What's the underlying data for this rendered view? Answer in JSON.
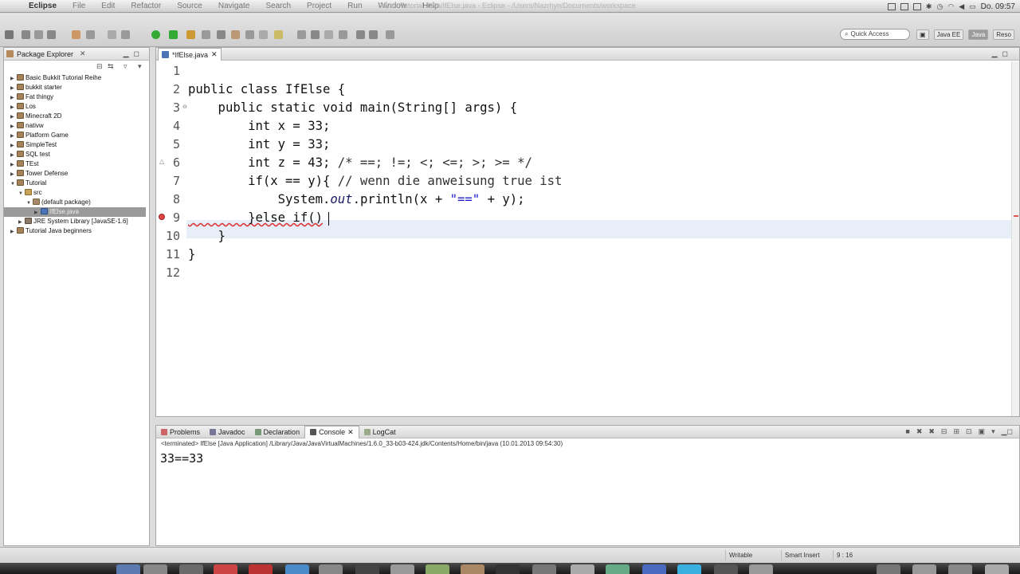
{
  "menubar": {
    "app": "Eclipse",
    "items": [
      "File",
      "Edit",
      "Refactor",
      "Source",
      "Navigate",
      "Search",
      "Project",
      "Run",
      "Window",
      "Help"
    ],
    "window_title": "Java - Tutorial Java/IfElse.java - Eclipse - /Users/Nazrhyn/Documents/workspace",
    "clock": "Do. 09:57"
  },
  "toolbar": {
    "quick_access_placeholder": "Quick Access",
    "perspectives": [
      "Java EE",
      "Java",
      "Reso"
    ]
  },
  "package_explorer": {
    "title": "Package Explorer",
    "items": [
      {
        "label": "Basic Bukkit Tutorial Reihe",
        "type": "proj",
        "arrow": "▶",
        "depth": 0
      },
      {
        "label": "bukkit starter",
        "type": "proj",
        "arrow": "▶",
        "depth": 0
      },
      {
        "label": "Fat thingy",
        "type": "proj",
        "arrow": "▶",
        "depth": 0
      },
      {
        "label": "Los",
        "type": "proj",
        "arrow": "▶",
        "depth": 0
      },
      {
        "label": "Minecraft 2D",
        "type": "proj",
        "arrow": "▶",
        "depth": 0
      },
      {
        "label": "nativw",
        "type": "proj",
        "arrow": "▶",
        "depth": 0
      },
      {
        "label": "Platform Game",
        "type": "proj",
        "arrow": "▶",
        "depth": 0
      },
      {
        "label": "SimpleTest",
        "type": "proj",
        "arrow": "▶",
        "depth": 0
      },
      {
        "label": "SQL test",
        "type": "proj",
        "arrow": "▶",
        "depth": 0
      },
      {
        "label": "TEst",
        "type": "proj",
        "arrow": "▶",
        "depth": 0
      },
      {
        "label": "Tower Defense",
        "type": "proj",
        "arrow": "▶",
        "depth": 0
      },
      {
        "label": "Tutorial",
        "type": "proj",
        "arrow": "▼",
        "depth": 0
      },
      {
        "label": "src",
        "type": "src",
        "arrow": "▼",
        "depth": 1
      },
      {
        "label": "(default package)",
        "type": "pkg",
        "arrow": "▼",
        "depth": 2
      },
      {
        "label": "IfElse.java",
        "type": "java",
        "arrow": "▶",
        "depth": 3,
        "selected": true
      },
      {
        "label": "JRE System Library [JavaSE-1.6]",
        "type": "jre",
        "arrow": "▶",
        "depth": 1
      },
      {
        "label": "Tutorial Java beginners",
        "type": "proj",
        "arrow": "▶",
        "depth": 0
      }
    ]
  },
  "editor": {
    "tab_label": "*IfElse.java",
    "line_numbers": [
      "1",
      "2",
      "3",
      "4",
      "5",
      "6",
      "7",
      "8",
      "9",
      "10",
      "11",
      "12"
    ],
    "lines": {
      "l2": "public class IfElse {",
      "l3": "    public static void main(String[] args) {",
      "l4": "        int x = 33;",
      "l5": "        int y = 33;",
      "l6a": "        int z = 43; ",
      "l6b": "/* ==; !=; <; <=; >; >= */",
      "l7a": "        if(x == y){ ",
      "l7b": "// wenn die anweisung true ist",
      "l8a": "            System.",
      "l8b": "out",
      "l8c": ".println(x + ",
      "l8d": "\"==\"",
      "l8e": " + y);",
      "l9": "        }else if()",
      "l10": "    }",
      "l11": "}"
    }
  },
  "bottom_panel": {
    "tabs": [
      "Problems",
      "Javadoc",
      "Declaration",
      "Console",
      "LogCat"
    ],
    "active_tab": "Console",
    "terminated_line": "<terminated> IfElse [Java Application] /Library/Java/JavaVirtualMachines/1.6.0_33-b03-424.jdk/Contents/Home/bin/java (10.01.2013 09:54:30)",
    "output": "33==33"
  },
  "status": {
    "writable": "Writable",
    "insert_mode": "Smart Insert",
    "position": "9 : 16"
  }
}
